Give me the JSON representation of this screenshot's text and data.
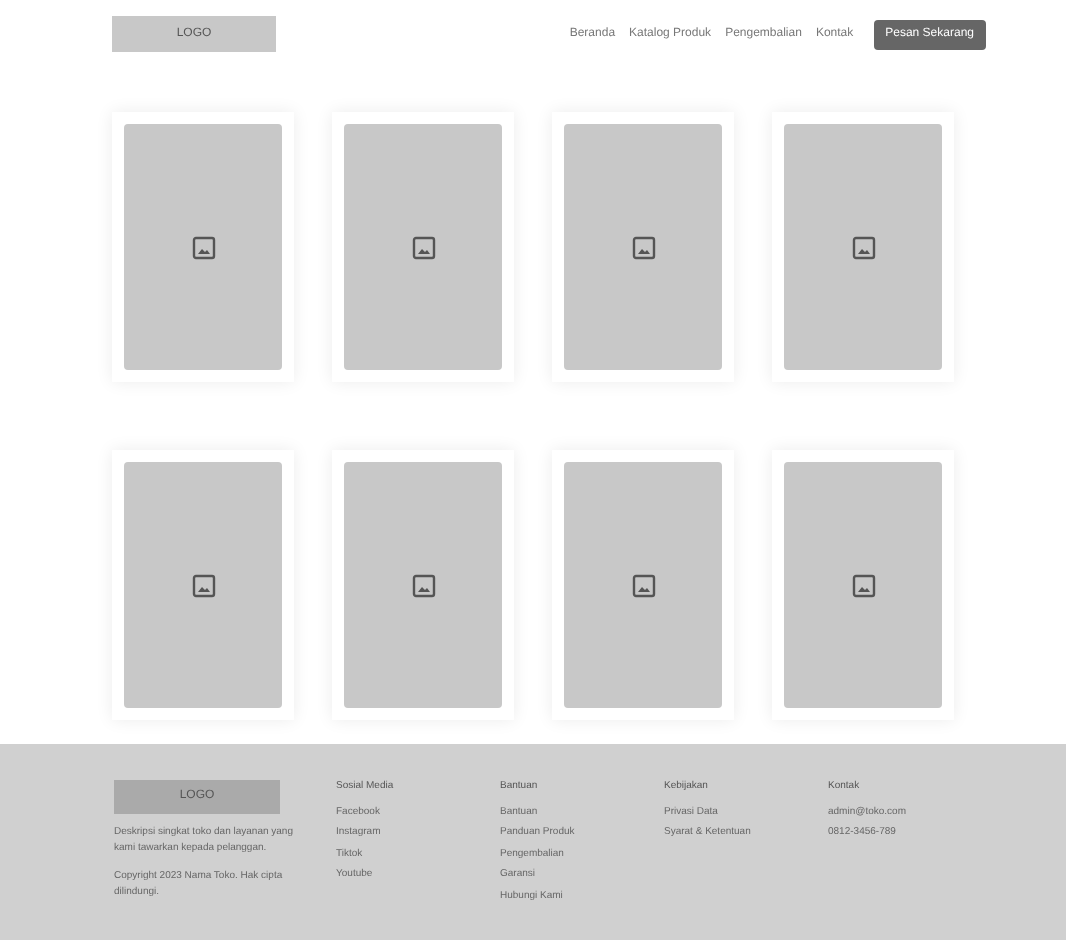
{
  "header": {
    "logo": "LOGO",
    "nav": [
      "Beranda",
      "Katalog Produk",
      "Pengembalian",
      "Kontak"
    ],
    "cta": "Pesan Sekarang"
  },
  "footer": {
    "logo": "LOGO",
    "description": "Deskripsi singkat toko dan layanan yang kami tawarkan kepada pelanggan.",
    "copyright": "Copyright 2023 Nama Toko. Hak cipta dilindungi.",
    "columns": [
      {
        "title": "Sosial Media",
        "links": [
          "Facebook",
          "Instagram",
          "Tiktok",
          "Youtube"
        ]
      },
      {
        "title": "Bantuan",
        "links": [
          "Bantuan",
          "Panduan Produk",
          "Pengembalian",
          "Garansi",
          "Hubungi Kami"
        ]
      },
      {
        "title": "Kebijakan",
        "links": [
          "Privasi Data",
          "Syarat & Ketentuan"
        ]
      },
      {
        "title": "Kontak",
        "links": [
          "admin@toko.com",
          "0812-3456-789"
        ]
      }
    ]
  }
}
